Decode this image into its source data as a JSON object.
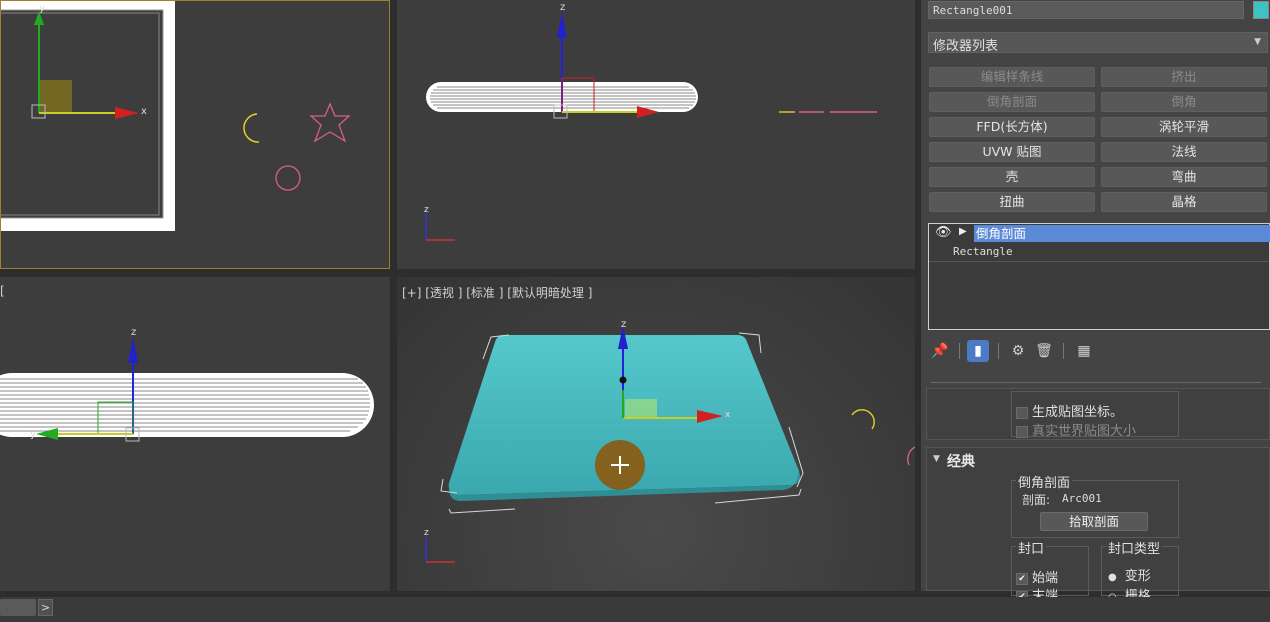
{
  "viewports": {
    "left_label": "[",
    "perspective_label": "[+] [透视 ] [标准 ] [默认明暗处理 ]",
    "axis_x": "x",
    "axis_y": "y",
    "axis_z": "z"
  },
  "panel": {
    "object_name": "Rectangle001",
    "object_color": "#3cc4c4",
    "modifier_list": "修改器列表",
    "modifier_buttons": [
      {
        "label": "编辑样条线",
        "enabled": false
      },
      {
        "label": "挤出",
        "enabled": false
      },
      {
        "label": "倒角剖面",
        "enabled": false
      },
      {
        "label": "倒角",
        "enabled": false
      },
      {
        "label": "FFD(长方体)",
        "enabled": true
      },
      {
        "label": "涡轮平滑",
        "enabled": true
      },
      {
        "label": "UVW 贴图",
        "enabled": true
      },
      {
        "label": "法线",
        "enabled": true
      },
      {
        "label": "壳",
        "enabled": true
      },
      {
        "label": "弯曲",
        "enabled": true
      },
      {
        "label": "扭曲",
        "enabled": true
      },
      {
        "label": "晶格",
        "enabled": true
      }
    ],
    "stack": {
      "selected": "倒角剖面",
      "base": "Rectangle"
    },
    "mapping": {
      "gen_coords": "生成贴图坐标。",
      "real_world": "真实世界贴图大小"
    },
    "classic": {
      "rollout_title": "经典",
      "group_title": "倒角剖面",
      "profile_label": "剖面:",
      "profile_value": "Arc001",
      "pick_button": "拾取剖面",
      "cap_title": "封口",
      "cap_start": "始端",
      "cap_end": "末端",
      "cap_type_title": "封口类型",
      "cap_type_morph": "变形",
      "cap_type_grid": "栅格"
    }
  }
}
